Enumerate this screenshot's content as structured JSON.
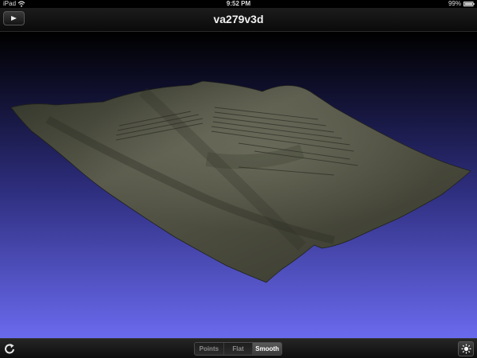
{
  "status_bar": {
    "device": "iPad",
    "time": "9:52 PM",
    "battery": "99%"
  },
  "nav_bar": {
    "title": "va279v3d",
    "play_icon": "play-icon"
  },
  "viewport": {
    "content": "3d-mesh-parchment",
    "background_top": "#000000",
    "background_bottom": "#6a6aee"
  },
  "toolbar": {
    "refresh_icon": "refresh-icon",
    "light_icon": "sun-icon",
    "render_modes": [
      {
        "label": "Points",
        "selected": false
      },
      {
        "label": "Flat",
        "selected": false
      },
      {
        "label": "Smooth",
        "selected": true
      }
    ]
  }
}
